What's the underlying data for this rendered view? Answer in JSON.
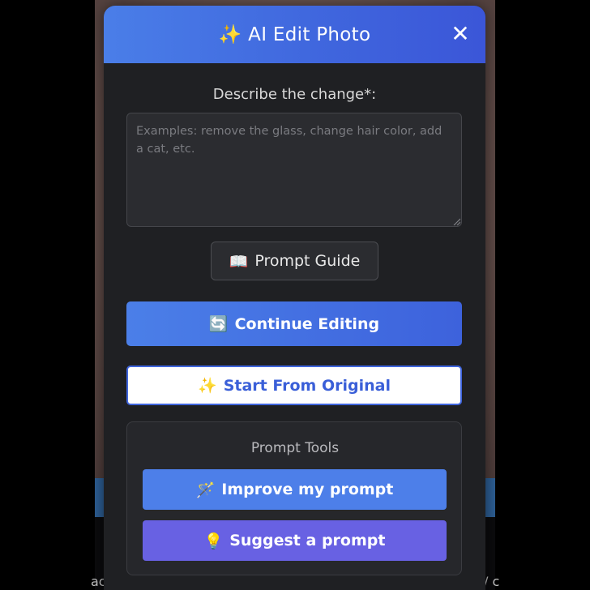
{
  "background": {
    "left_edge_text": "ac",
    "right_edge_text": "/ c"
  },
  "modal": {
    "title": "✨ AI Edit Photo",
    "close_glyph": "✕",
    "field_label": "Describe the change*:",
    "textarea": {
      "value": "",
      "placeholder": "Examples: remove the glass, change hair color, add a cat, etc."
    },
    "prompt_guide": {
      "icon": "📖",
      "label": "Prompt Guide"
    },
    "continue_editing": {
      "icon": "🔄",
      "label": "Continue Editing"
    },
    "start_from_original": {
      "icon": "✨",
      "label": "Start From Original"
    },
    "prompt_tools": {
      "title": "Prompt Tools",
      "improve": {
        "icon": "🪄",
        "label": "Improve my prompt"
      },
      "suggest": {
        "icon": "💡",
        "label": "Suggest a prompt"
      }
    }
  },
  "colors": {
    "header_gradient_start": "#4a7ee8",
    "header_gradient_end": "#3b56d8",
    "modal_bg": "#1f2023",
    "improve_button": "#4d7fe9",
    "suggest_button": "#6861e3"
  }
}
